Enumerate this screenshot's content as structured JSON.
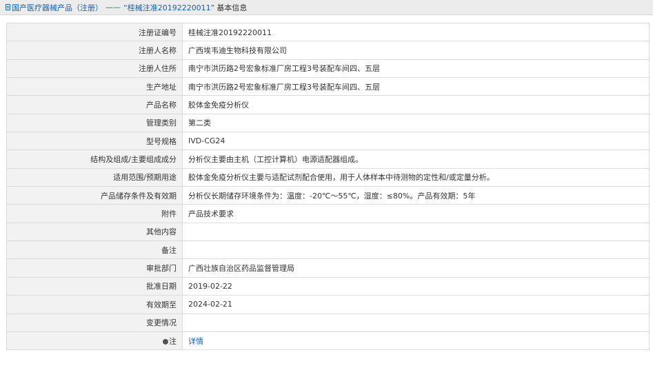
{
  "breadcrumb": {
    "root_label": "国产医疗器械产品（注册）",
    "separator": "——",
    "item_label": "“桂械注准20192220011”",
    "current_label": "基本信息"
  },
  "rows": [
    {
      "label": "注册证编号",
      "value": "桂械注准20192220011"
    },
    {
      "label": "注册人名称",
      "value": "广西埃韦迪生物科技有限公司"
    },
    {
      "label": "注册人住所",
      "value": "南宁市洪历路2号宏象标准厂房工程3号装配车间四、五层"
    },
    {
      "label": "生产地址",
      "value": "南宁市洪历路2号宏象标准厂房工程3号装配车间四、五层"
    },
    {
      "label": "产品名称",
      "value": "胶体金免疫分析仪"
    },
    {
      "label": "管理类别",
      "value": "第二类"
    },
    {
      "label": "型号规格",
      "value": "IVD-CG24"
    },
    {
      "label": "结构及组成/主要组成成分",
      "value": "分析仪主要由主机（工控计算机）电源适配器组成。"
    },
    {
      "label": "适用范围/预期用途",
      "value": "胶体金免疫分析仪主要与适配试剂配合使用，用于人体样本中待测物的定性和/或定量分析。"
    },
    {
      "label": "产品储存条件及有效期",
      "value": "分析仪长期储存环境条件为：温度：-20℃～55℃，湿度：≤80%。产品有效期：5年"
    },
    {
      "label": "附件",
      "value": "产品技术要求"
    },
    {
      "label": "其他内容",
      "value": ""
    },
    {
      "label": "备注",
      "value": ""
    },
    {
      "label": "审批部门",
      "value": "广西壮族自治区药品监督管理局"
    },
    {
      "label": "批准日期",
      "value": "2019-02-22"
    },
    {
      "label": "有效期至",
      "value": "2024-02-21"
    },
    {
      "label": "变更情况",
      "value": ""
    }
  ],
  "note_row": {
    "label": "注",
    "icon": "bullet-icon",
    "link_label": "详情"
  }
}
